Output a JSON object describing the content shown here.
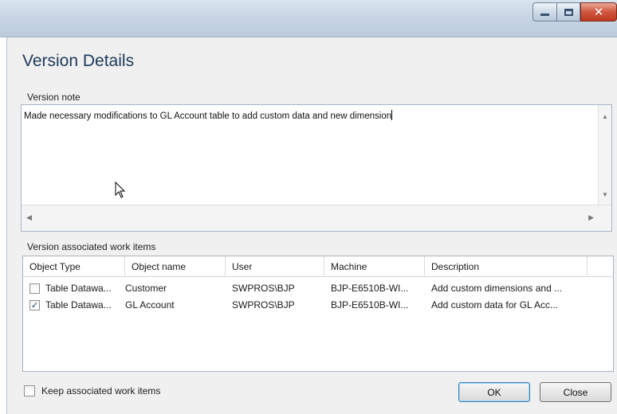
{
  "dialog": {
    "title": "Version Details",
    "note_label": "Version note",
    "note_text": "Made necessary modifications to GL Account table to add custom data and new dimension",
    "items_label": "Version associated work items"
  },
  "table": {
    "columns": [
      "Object Type",
      "Object name",
      "User",
      "Machine",
      "Description"
    ],
    "rows": [
      {
        "checked": false,
        "object_type": "Table Datawa...",
        "object_name": "Customer",
        "user": "SWPROS\\BJP",
        "machine": "BJP-E6510B-WI...",
        "description": "Add custom dimensions and ..."
      },
      {
        "checked": true,
        "object_type": "Table Datawa...",
        "object_name": "GL Account",
        "user": "SWPROS\\BJP",
        "machine": "BJP-E6510B-WI...",
        "description": "Add custom data for GL Acc..."
      }
    ]
  },
  "footer": {
    "keep_label": "Keep associated work items",
    "ok_label": "OK",
    "close_label": "Close"
  },
  "icons": {
    "minimize": "minimize-icon",
    "maximize": "maximize-icon",
    "close": "close-icon",
    "check": "✓"
  },
  "colors": {
    "title_text": "#1e395b",
    "close_button": "#c8472e"
  }
}
